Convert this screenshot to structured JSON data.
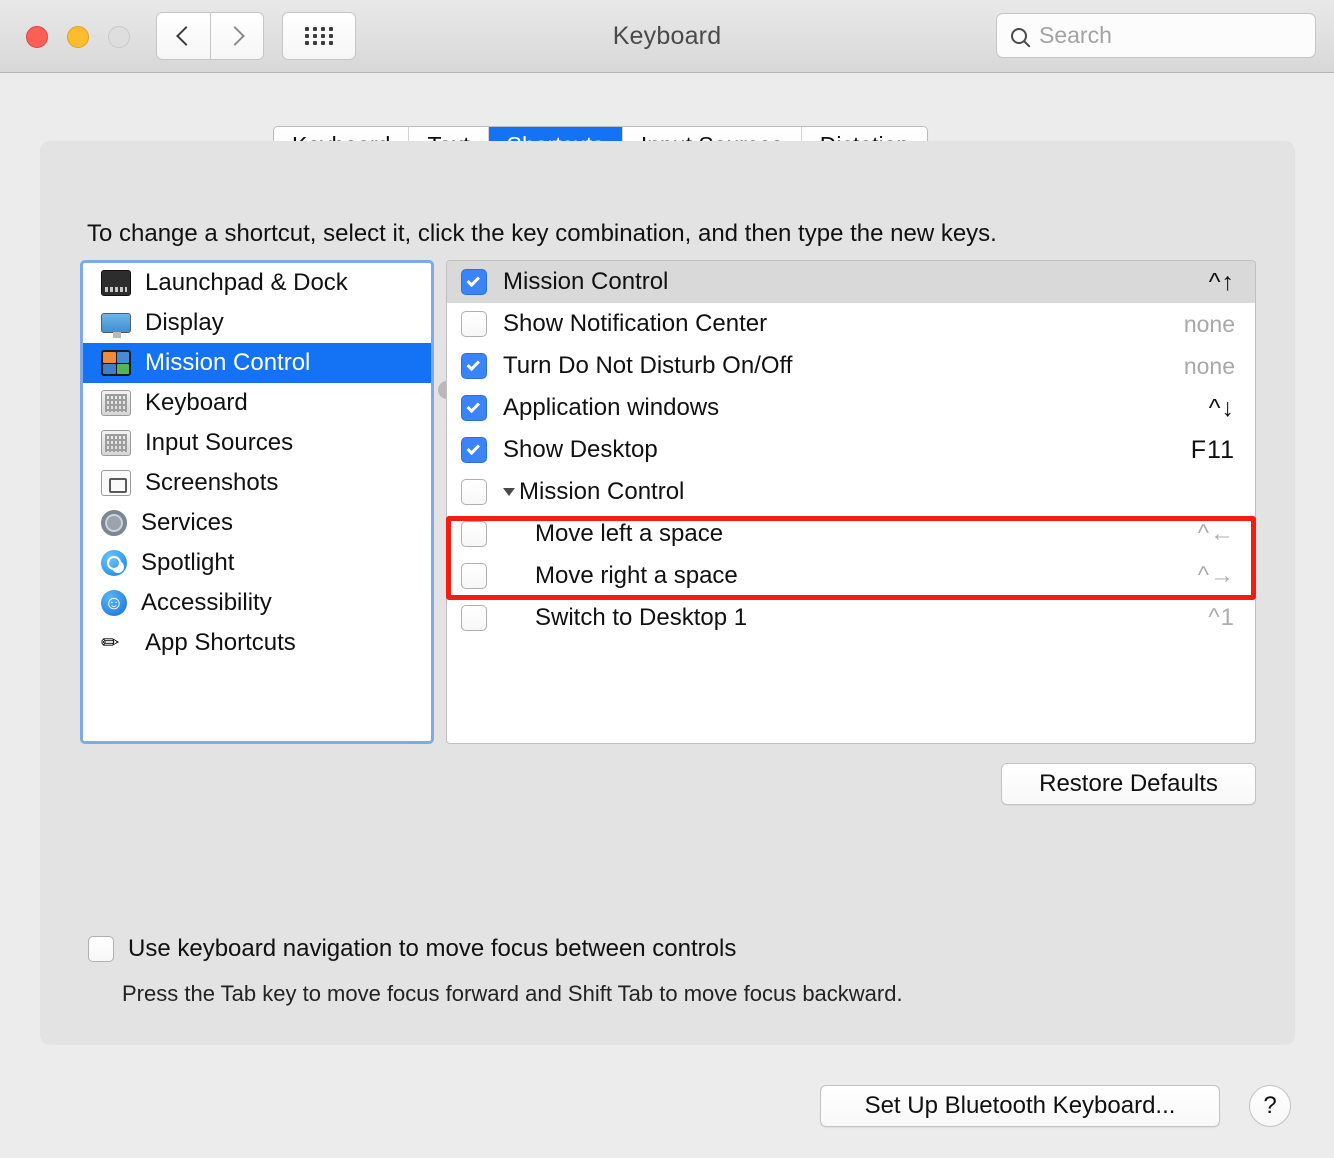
{
  "window": {
    "title": "Keyboard",
    "traffic_lights": [
      "close-button",
      "minimize-button",
      "zoom-button"
    ],
    "nav": {
      "back": "back-icon",
      "forward": "forward-icon",
      "show_all": "grid-icon"
    },
    "search": {
      "placeholder": "Search",
      "value": "",
      "icon": "search-icon"
    }
  },
  "tabs": [
    {
      "label": "Keyboard",
      "active": false
    },
    {
      "label": "Text",
      "active": false
    },
    {
      "label": "Shortcuts",
      "active": true
    },
    {
      "label": "Input Sources",
      "active": false
    },
    {
      "label": "Dictation",
      "active": false
    }
  ],
  "hint": "To change a shortcut, select it, click the key combination, and then type the new keys.",
  "sidebar": {
    "items": [
      {
        "label": "Launchpad & Dock",
        "icon": "launchpad-dock-icon",
        "selected": false
      },
      {
        "label": "Display",
        "icon": "display-icon",
        "selected": false
      },
      {
        "label": "Mission Control",
        "icon": "mission-control-icon",
        "selected": true
      },
      {
        "label": "Keyboard",
        "icon": "keyboard-icon",
        "selected": false
      },
      {
        "label": "Input Sources",
        "icon": "input-sources-icon",
        "selected": false
      },
      {
        "label": "Screenshots",
        "icon": "screenshots-icon",
        "selected": false
      },
      {
        "label": "Services",
        "icon": "services-gear-icon",
        "selected": false
      },
      {
        "label": "Spotlight",
        "icon": "spotlight-icon",
        "selected": false
      },
      {
        "label": "Accessibility",
        "icon": "accessibility-icon",
        "selected": false
      },
      {
        "label": "App Shortcuts",
        "icon": "app-shortcuts-icon",
        "selected": false
      }
    ]
  },
  "shortcuts": {
    "rows": [
      {
        "name": "Mission Control",
        "key": "^↑",
        "checked": true,
        "selected": true,
        "level": 0,
        "key_style": "normal"
      },
      {
        "name": "Show Notification Center",
        "key": "none",
        "checked": false,
        "selected": false,
        "level": 0,
        "key_style": "none"
      },
      {
        "name": "Turn Do Not Disturb On/Off",
        "key": "none",
        "checked": true,
        "selected": false,
        "level": 0,
        "key_style": "none"
      },
      {
        "name": "Application windows",
        "key": "^↓",
        "checked": true,
        "selected": false,
        "level": 0,
        "key_style": "normal"
      },
      {
        "name": "Show Desktop",
        "key": "F11",
        "checked": true,
        "selected": false,
        "level": 0,
        "key_style": "normal"
      },
      {
        "name": "Mission Control",
        "key": "",
        "checked": false,
        "selected": false,
        "level": 0,
        "group": true,
        "key_style": "normal"
      },
      {
        "name": "Move left a space",
        "key": "^←",
        "checked": false,
        "selected": false,
        "level": 1,
        "key_style": "muted"
      },
      {
        "name": "Move right a space",
        "key": "^→",
        "checked": false,
        "selected": false,
        "level": 1,
        "key_style": "muted"
      },
      {
        "name": "Switch to Desktop 1",
        "key": "^1",
        "checked": false,
        "selected": false,
        "level": 1,
        "key_style": "muted"
      }
    ],
    "highlight_color": "#f51c11",
    "highlighted_rows": [
      "Move left a space",
      "Move right a space"
    ]
  },
  "buttons": {
    "restore_defaults": "Restore Defaults",
    "set_up_bluetooth_keyboard": "Set Up Bluetooth Keyboard...",
    "help": "?"
  },
  "keyboard_navigation": {
    "label": "Use keyboard navigation to move focus between controls",
    "checked": false,
    "description": "Press the Tab key to move focus forward and Shift Tab to move focus backward."
  },
  "colors": {
    "accent": "#1473f5",
    "checkbox": "#3b84f7",
    "highlight": "#f51c11"
  }
}
